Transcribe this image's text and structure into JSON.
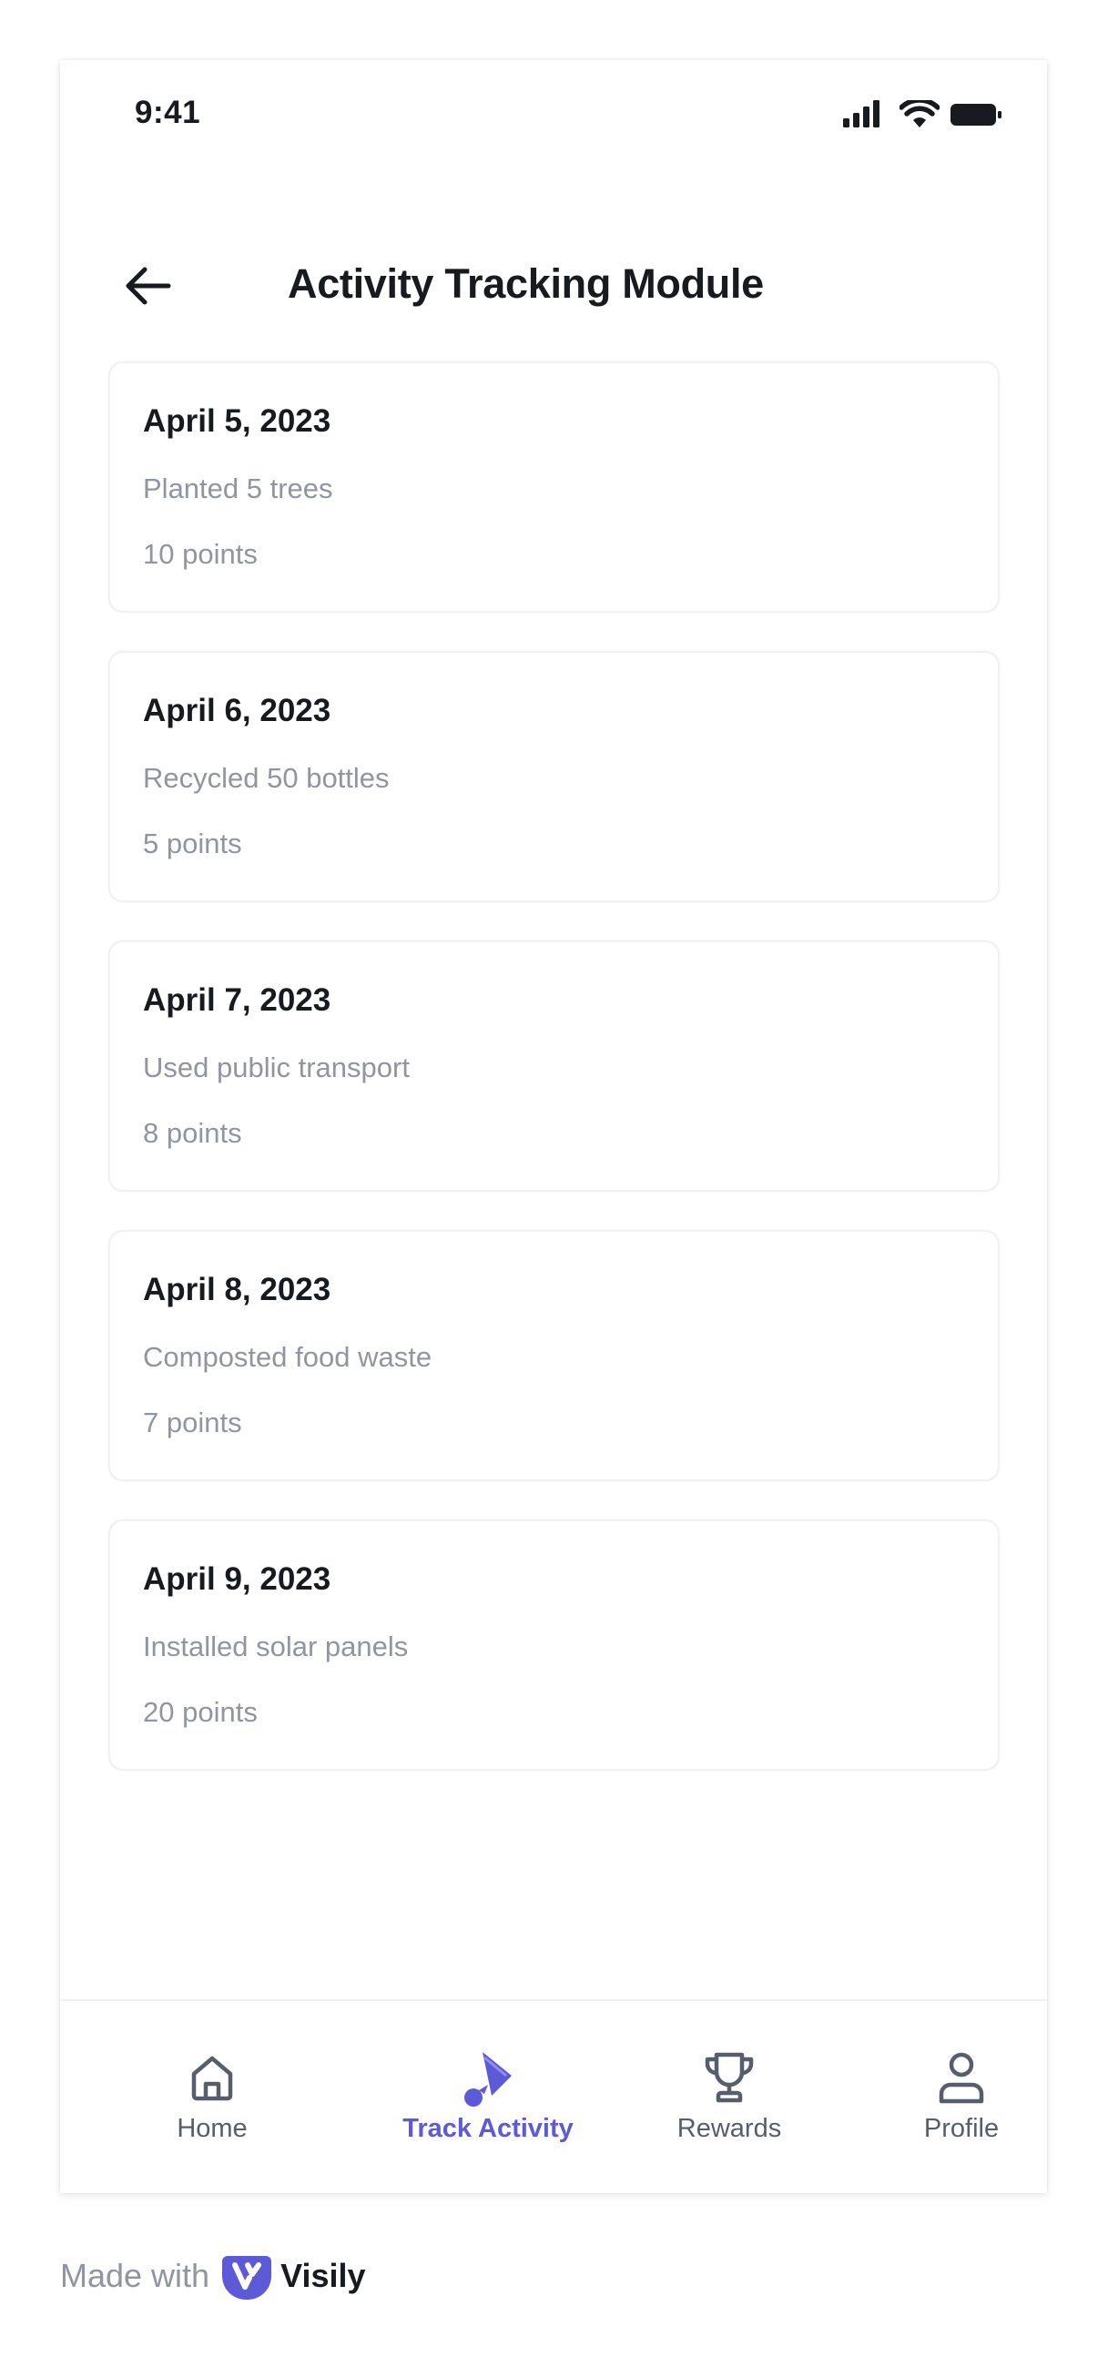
{
  "status_bar": {
    "time": "9:41"
  },
  "header": {
    "title": "Activity Tracking Module",
    "back_icon": "arrow-left-icon"
  },
  "activities": [
    {
      "date": "April 5, 2023",
      "description": "Planted 5 trees",
      "points": "10 points"
    },
    {
      "date": "April 6, 2023",
      "description": "Recycled 50 bottles",
      "points": "5 points"
    },
    {
      "date": "April 7, 2023",
      "description": "Used public transport",
      "points": "8 points"
    },
    {
      "date": "April 8, 2023",
      "description": "Composted food waste",
      "points": "7 points"
    },
    {
      "date": "April 9, 2023",
      "description": "Installed solar panels",
      "points": "20 points"
    }
  ],
  "bottom_nav": {
    "items": [
      {
        "label": "Home",
        "icon": "home-icon",
        "active": false
      },
      {
        "label": "Track Activity",
        "icon": "badminton-icon",
        "active": true
      },
      {
        "label": "Rewards",
        "icon": "trophy-icon",
        "active": false
      },
      {
        "label": "Profile",
        "icon": "user-icon",
        "active": false
      }
    ]
  },
  "footer": {
    "made_with": "Made with",
    "brand": "Visily"
  },
  "colors": {
    "accent": "#5d5ad8",
    "text_primary": "#171a1f",
    "text_secondary": "#9095a0",
    "nav_inactive": "#565d6d",
    "card_border": "#f0f1f3"
  }
}
